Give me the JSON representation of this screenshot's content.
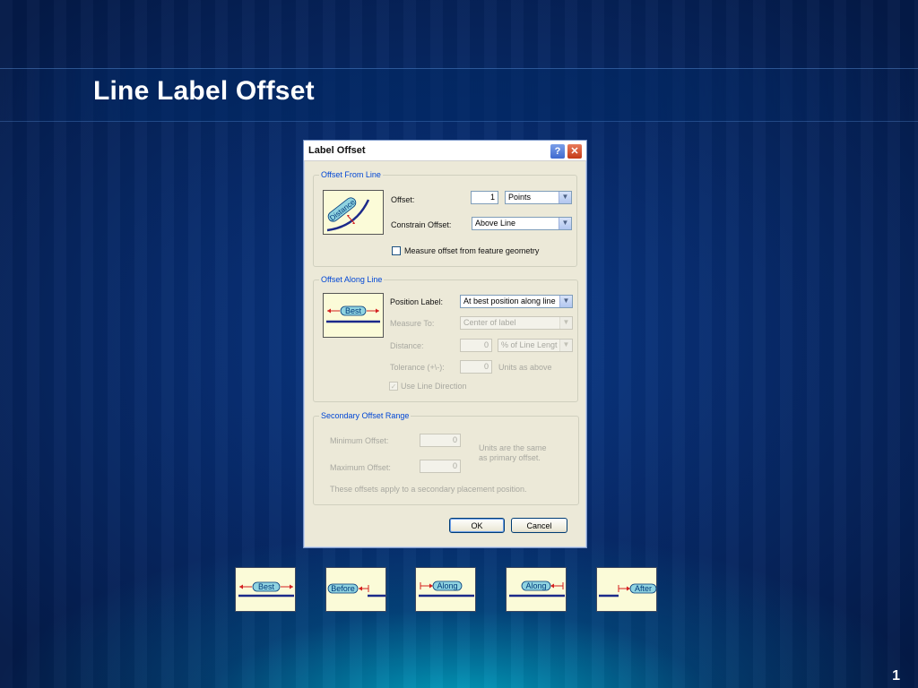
{
  "slide": {
    "title": "Line Label Offset",
    "page_number": "1"
  },
  "dialog": {
    "title": "Label Offset",
    "help_glyph": "?",
    "close_glyph": "✕",
    "offset_from_line": {
      "group_label": "Offset From Line",
      "illustration_text": "Distance",
      "offset_label": "Offset:",
      "offset_value": "1",
      "offset_unit": "Points",
      "constrain_label": "Constrain Offset:",
      "constrain_value": "Above Line",
      "measure_checkbox_label": "Measure offset from feature geometry",
      "measure_checked": false
    },
    "offset_along_line": {
      "group_label": "Offset Along Line",
      "illustration_text": "Best",
      "position_label": "Position Label:",
      "position_value": "At best position along line",
      "measure_to_label": "Measure To:",
      "measure_to_value": "Center of label",
      "distance_label": "Distance:",
      "distance_value": "0",
      "distance_unit": "% of Line Lengt",
      "tolerance_label": "Tolerance (+\\-):",
      "tolerance_value": "0",
      "tolerance_unit": "Units as above",
      "line_direction_label": "Use Line Direction",
      "line_direction_checked": true
    },
    "secondary_offset": {
      "group_label": "Secondary Offset Range",
      "min_label": "Minimum Offset:",
      "min_value": "0",
      "max_label": "Maximum Offset:",
      "max_value": "0",
      "note_line1": "Units are the same",
      "note_line2": "as primary offset.",
      "footer_note": "These offsets apply to a secondary placement position."
    },
    "ok_label": "OK",
    "cancel_label": "Cancel"
  },
  "thumbnails": [
    {
      "text": "Best"
    },
    {
      "text": "Before"
    },
    {
      "text": "Along"
    },
    {
      "text": "Along"
    },
    {
      "text": "After"
    }
  ],
  "colors": {
    "accent_blue": "#0046d5",
    "line_navy": "#1c2a8a",
    "arrow_red": "#d42020",
    "pill_fill": "#8fd3e0"
  }
}
